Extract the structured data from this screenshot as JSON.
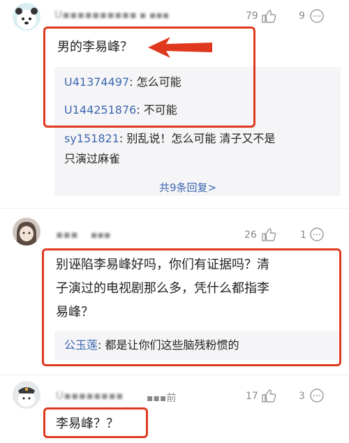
{
  "comments": [
    {
      "username": "U▪▪▪▪▪▪▪▪▪▪",
      "time": "▪ ▪▪▪",
      "likes": "79",
      "replies": "9",
      "content": "男的李易峰？",
      "reply_list": [
        {
          "user": "U41374497",
          "text": ": 怎么可能"
        },
        {
          "user": "U144251876",
          "text": ": 不可能"
        },
        {
          "user": "sy151821",
          "text": ": 别乱说！怎么可能 清子又不是"
        },
        {
          "user": "",
          "text": "只演过麻雀"
        }
      ],
      "more_replies": "共9条回复>"
    },
    {
      "username": "▪▪▪",
      "time": "▪▪▪",
      "likes": "26",
      "replies": "1",
      "content_lines": [
        "别诬陷李易峰好吗，你们有证据吗？清",
        "子演过的电视剧那么多，凭什么都指李",
        "易峰？"
      ],
      "reply_list": [
        {
          "user": "公玉莲",
          "text": ": 都是让你们这些脑残粉惯的"
        }
      ]
    },
    {
      "username": "U▪▪▪▪▪▪▪▪",
      "time": "▪▪▪前",
      "likes": "17",
      "replies": "3",
      "content": "李易峰？？"
    }
  ],
  "colors": {
    "annotation_red": "#e0381f",
    "link_blue": "#3e67b1"
  }
}
